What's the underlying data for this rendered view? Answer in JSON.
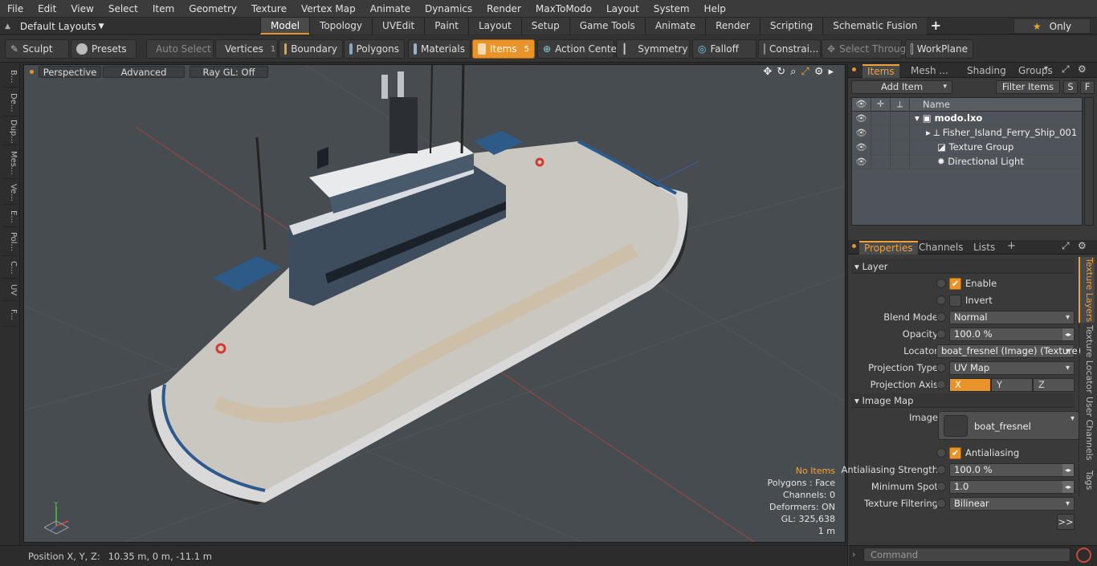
{
  "menu": [
    "File",
    "Edit",
    "View",
    "Select",
    "Item",
    "Geometry",
    "Texture",
    "Vertex Map",
    "Animate",
    "Dynamics",
    "Render",
    "MaxToModo",
    "Layout",
    "System",
    "Help"
  ],
  "layouts": {
    "label": "Default Layouts"
  },
  "tabs": [
    "Model",
    "Topology",
    "UVEdit",
    "Paint",
    "Layout",
    "Setup",
    "Game Tools",
    "Animate",
    "Render",
    "Scripting",
    "Schematic Fusion"
  ],
  "only_label": "Only",
  "toolbar": {
    "sculpt": "Sculpt",
    "presets": "Presets",
    "auto_select": "Auto Select",
    "vertices": "Vertices",
    "vertices_count": "1",
    "boundary": "Boundary",
    "polygons": "Polygons",
    "materials": "Materials",
    "items": "Items",
    "items_count": "5",
    "action_center": "Action Center",
    "symmetry": "Symmetry",
    "falloff": "Falloff",
    "constrain": "Constrai...",
    "select_through": "Select Through",
    "workplane": "WorkPlane"
  },
  "left_tabs": [
    "B...",
    "De...",
    "Dup...",
    "Mes...",
    "Ve...",
    "E...",
    "Pol...",
    "C...",
    "UV",
    "F..."
  ],
  "viewport": {
    "perspective": "Perspective",
    "advanced": "Advanced",
    "raygl": "Ray GL: Off",
    "stats": {
      "no_items": "No Items",
      "polygons": "Polygons : Face",
      "channels": "Channels: 0",
      "deformers": "Deformers: ON",
      "gl": "GL: 325,638",
      "scale": "1 m"
    }
  },
  "status": {
    "label": "Position X, Y, Z:",
    "value": "10.35 m, 0 m, -11.1 m"
  },
  "items_panel": {
    "tabs": [
      "Items",
      "Mesh ...",
      "Shading",
      "Groups"
    ],
    "add_item": "Add Item",
    "filter_items": "Filter Items",
    "s": "S",
    "f": "F",
    "name_header": "Name",
    "rows": [
      "modo.lxo",
      "Fisher_Island_Ferry_Ship_001",
      "Texture Group",
      "Directional Light"
    ]
  },
  "properties_panel": {
    "tabs": [
      "Properties",
      "Channels",
      "Lists"
    ],
    "layer_section": "Layer",
    "enable": "Enable",
    "invert": "Invert",
    "blend_mode": {
      "label": "Blend Mode",
      "value": "Normal"
    },
    "opacity": {
      "label": "Opacity",
      "value": "100.0 %"
    },
    "locator": {
      "label": "Locator",
      "value": "boat_fresnel (Image) (Texture)"
    },
    "projection_type": {
      "label": "Projection Type",
      "value": "UV Map"
    },
    "projection_axis": {
      "label": "Projection Axis",
      "x": "X",
      "y": "Y",
      "z": "Z"
    },
    "image_map_section": "Image Map",
    "image": {
      "label": "Image",
      "value": "boat_fresnel"
    },
    "antialiasing": "Antialiasing",
    "aa_strength": {
      "label": "Antialiasing Strength",
      "value": "100.0 %"
    },
    "min_spot": {
      "label": "Minimum Spot",
      "value": "1.0"
    },
    "tex_filtering": {
      "label": "Texture Filtering",
      "value": "Bilinear"
    },
    "more": ">>",
    "side_tabs": [
      "Texture Layers",
      "Texture Locator",
      "User Channels",
      "Tags"
    ]
  },
  "command": {
    "placeholder": "Command"
  },
  "colors": {
    "accent": "#e8942a",
    "viewport_bg": "#474c51"
  }
}
